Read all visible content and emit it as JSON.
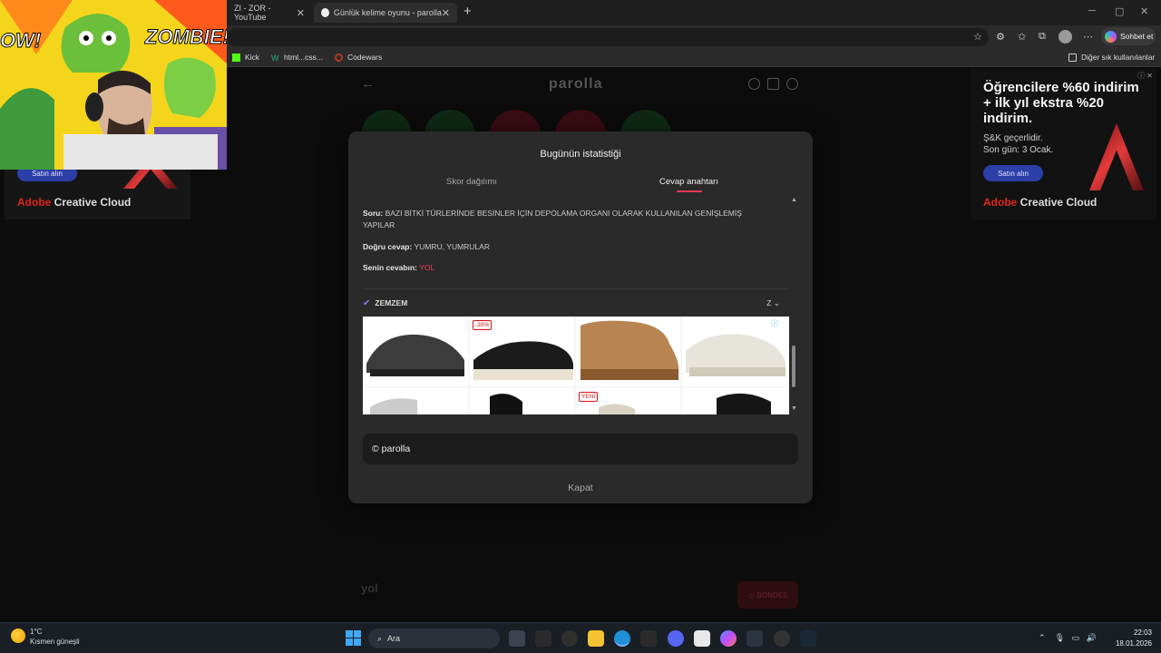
{
  "browser": {
    "tabs": [
      {
        "title": "ZI - ZOR - YouTube"
      },
      {
        "title": "Günlük kelime oyunu - parolla - Ki"
      }
    ],
    "new_tab": "+",
    "copilot_label": "Sohbet et",
    "bookmarks": [
      "Kick",
      "html...css...",
      "Codewars"
    ],
    "other_bookmarks": "Diğer sık kullanılanlar"
  },
  "ads": {
    "title": "Öğrencilere %60 indirim + ilk yıl ekstra %20 indirim.",
    "subtitle_line1": "Ş&K geçerlidir.",
    "subtitle_line2": "Son gün: 3 Ocak.",
    "button": "Satın alın",
    "brand_prefix": "Adobe",
    "brand_suffix": " Creative Cloud"
  },
  "game": {
    "logo": "parolla",
    "answer_input": "yol",
    "skip_button": "◎ BONDE5"
  },
  "modal": {
    "title": "Bugünün istatistiği",
    "tabs": {
      "score": "Skor dağılımı",
      "answers": "Cevap anahtarı"
    },
    "question_label": "Soru:",
    "question_text": "BAZI BİTKİ TÜRLERİNDE BESİNLER İÇİN DEPOLAMA ORGANI OLARAK KULLANILAN GENİŞLEMİŞ YAPILAR",
    "correct_label": "Doğru cevap:",
    "correct_text": "YUMRU, YUMRULAR",
    "your_label": "Senin cevabın:",
    "your_text": "YOL",
    "next_word": "ZEMZEM",
    "next_letter": "Z",
    "ad_badges": {
      "discount": "-30%",
      "new": "YENİ"
    },
    "footer": "© parolla",
    "close": "Kapat"
  },
  "webcam": {
    "caption_left": "OW!",
    "caption_right": "ZOMBIE!"
  },
  "taskbar": {
    "weather_temp": "1°C",
    "weather_desc": "Kısmen güneşli",
    "search_placeholder": "Ara",
    "time": "22:03",
    "date": "18.01.2026"
  },
  "colors": {
    "accent": "#e83a55",
    "correct_check": "#8b7cf0"
  }
}
